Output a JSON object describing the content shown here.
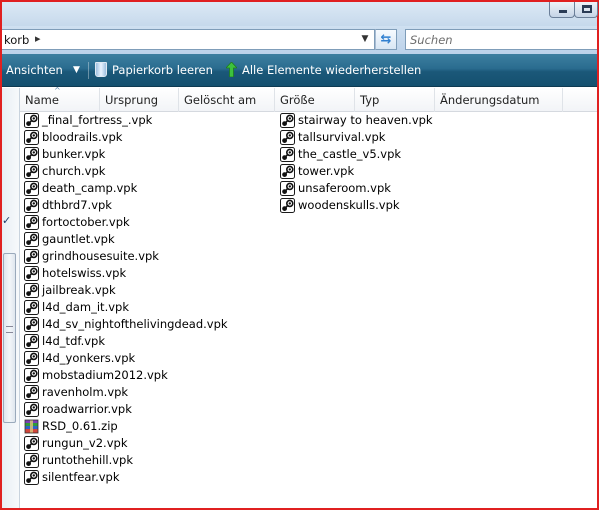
{
  "window": {
    "title_controls": [
      "minimize",
      "maximize"
    ]
  },
  "address": {
    "breadcrumb": "korb",
    "chevron": "▸",
    "dropdown": "▼",
    "refresh_icon": "refresh-icon",
    "search_placeholder": "Suchen"
  },
  "toolbar": {
    "views_label": "Ansichten",
    "views_arrow": "▼",
    "empty_bin_label": "Papierkorb leeren",
    "restore_all_label": "Alle Elemente wiederherstellen"
  },
  "columns": {
    "name": "Name",
    "origin": "Ursprung",
    "deleted": "Gelöscht am",
    "size": "Größe",
    "type": "Typ",
    "modified": "Änderungsdatum",
    "sort_indicator": "^"
  },
  "nav": {
    "check_mark": "✓"
  },
  "files_col1": [
    {
      "name": "_final_fortress_.vpk",
      "icon": "steam-icon"
    },
    {
      "name": "bloodrails.vpk",
      "icon": "steam-icon"
    },
    {
      "name": "bunker.vpk",
      "icon": "steam-icon"
    },
    {
      "name": "church.vpk",
      "icon": "steam-icon"
    },
    {
      "name": "death_camp.vpk",
      "icon": "steam-icon"
    },
    {
      "name": "dthbrd7.vpk",
      "icon": "steam-icon"
    },
    {
      "name": "fortoctober.vpk",
      "icon": "steam-icon"
    },
    {
      "name": "gauntlet.vpk",
      "icon": "steam-icon"
    },
    {
      "name": "grindhousesuite.vpk",
      "icon": "steam-icon"
    },
    {
      "name": "hotelswiss.vpk",
      "icon": "steam-icon"
    },
    {
      "name": "jailbreak.vpk",
      "icon": "steam-icon"
    },
    {
      "name": "l4d_dam_it.vpk",
      "icon": "steam-icon"
    },
    {
      "name": "l4d_sv_nightofthelivingdead.vpk",
      "icon": "steam-icon"
    },
    {
      "name": "l4d_tdf.vpk",
      "icon": "steam-icon"
    },
    {
      "name": "l4d_yonkers.vpk",
      "icon": "steam-icon"
    },
    {
      "name": "mobstadium2012.vpk",
      "icon": "steam-icon"
    },
    {
      "name": "ravenholm.vpk",
      "icon": "steam-icon"
    },
    {
      "name": "roadwarrior.vpk",
      "icon": "steam-icon"
    },
    {
      "name": "RSD_0.61.zip",
      "icon": "zip-archive-icon"
    },
    {
      "name": "rungun_v2.vpk",
      "icon": "steam-icon"
    },
    {
      "name": "runtothehill.vpk",
      "icon": "steam-icon"
    },
    {
      "name": "silentfear.vpk",
      "icon": "steam-icon"
    }
  ],
  "files_col2": [
    {
      "name": "stairway to heaven.vpk",
      "icon": "steam-icon"
    },
    {
      "name": "tallsurvival.vpk",
      "icon": "steam-icon"
    },
    {
      "name": "the_castle_v5.vpk",
      "icon": "steam-icon"
    },
    {
      "name": "tower.vpk",
      "icon": "steam-icon"
    },
    {
      "name": "unsaferoom.vpk",
      "icon": "steam-icon"
    },
    {
      "name": "woodenskulls.vpk",
      "icon": "steam-icon"
    }
  ]
}
